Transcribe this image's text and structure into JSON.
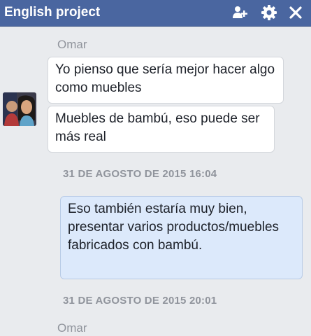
{
  "header": {
    "title": "English project",
    "icons": [
      "add-person-icon",
      "gear-icon",
      "close-icon"
    ]
  },
  "messages": {
    "sender_top": "Omar",
    "bubble_1": "Yo pienso que sería mejor hacer algo como muebles",
    "bubble_2": "Muebles de bambú, eso puede ser más real",
    "timestamp_1": "31 DE AGOSTO DE 2015 16:04",
    "bubble_3": "Eso también estaría muy bien, presentar varios productos/muebles fabricados con bambú.",
    "timestamp_2": "31 DE AGOSTO DE 2015 20:01",
    "sender_bottom": "Omar"
  },
  "colors": {
    "header_bg": "#4a66a0",
    "chat_bg": "#e9ebee",
    "own_bubble_bg": "#dce9fb",
    "other_bubble_bg": "#ffffff"
  }
}
